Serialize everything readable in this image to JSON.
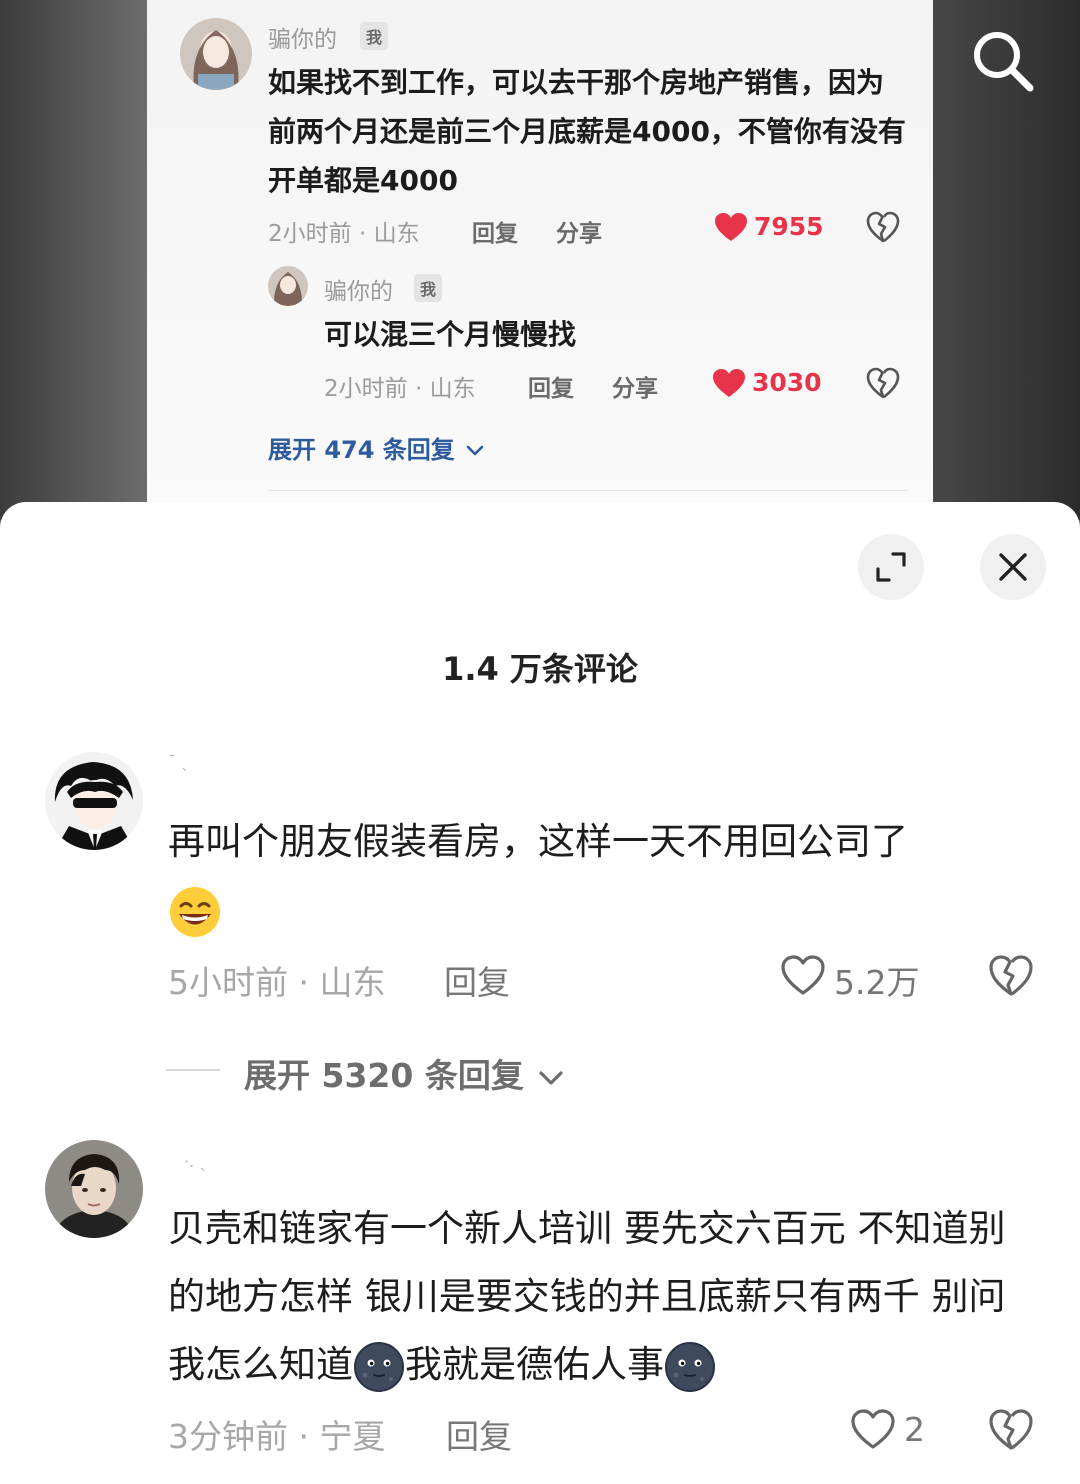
{
  "background": {
    "comment": {
      "username": "骗你的",
      "badge": "我",
      "text": "如果找不到工作，可以去干那个房地产销售，因为前两个月还是前三个月底薪是4000，不管你有没有开单都是4000",
      "time_location": "2小时前 · 山东",
      "reply_label": "回复",
      "share_label": "分享",
      "likes": "7955"
    },
    "reply": {
      "username": "骗你的",
      "badge": "我",
      "text": "可以混三个月慢慢找",
      "time_location": "2小时前 · 山东",
      "reply_label": "回复",
      "share_label": "分享",
      "likes": "3030"
    },
    "expand_label": "展开 474 条回复"
  },
  "sheet": {
    "title": "1.4 万条评论",
    "comments": [
      {
        "username": "ˉ ˎ",
        "text": "再叫个朋友假装看房，这样一天不用回公司了",
        "time_location": "5小时前 · 山东",
        "reply_label": "回复",
        "likes": "5.2万",
        "expand_label": "展开 5320 条回复"
      },
      {
        "username": "·. ˎ",
        "text_part1": "贝壳和链家有一个新人培训  要先交六百元  不知道别的地方怎样  银川是要交钱的并且底薪只有两千  别问我怎么知道",
        "text_part2": "我就是德佑人事",
        "time_location": "3分钟前 · 宁夏",
        "reply_label": "回复",
        "likes": "2"
      }
    ]
  },
  "colors": {
    "like_red": "#e8344a",
    "link_blue": "#2d5b9d"
  },
  "icons": [
    "search-icon",
    "heart-icon",
    "broken-heart-icon",
    "expand-icon",
    "close-icon",
    "chevron-down-icon",
    "grin-emoji",
    "dark-moon-emoji"
  ]
}
